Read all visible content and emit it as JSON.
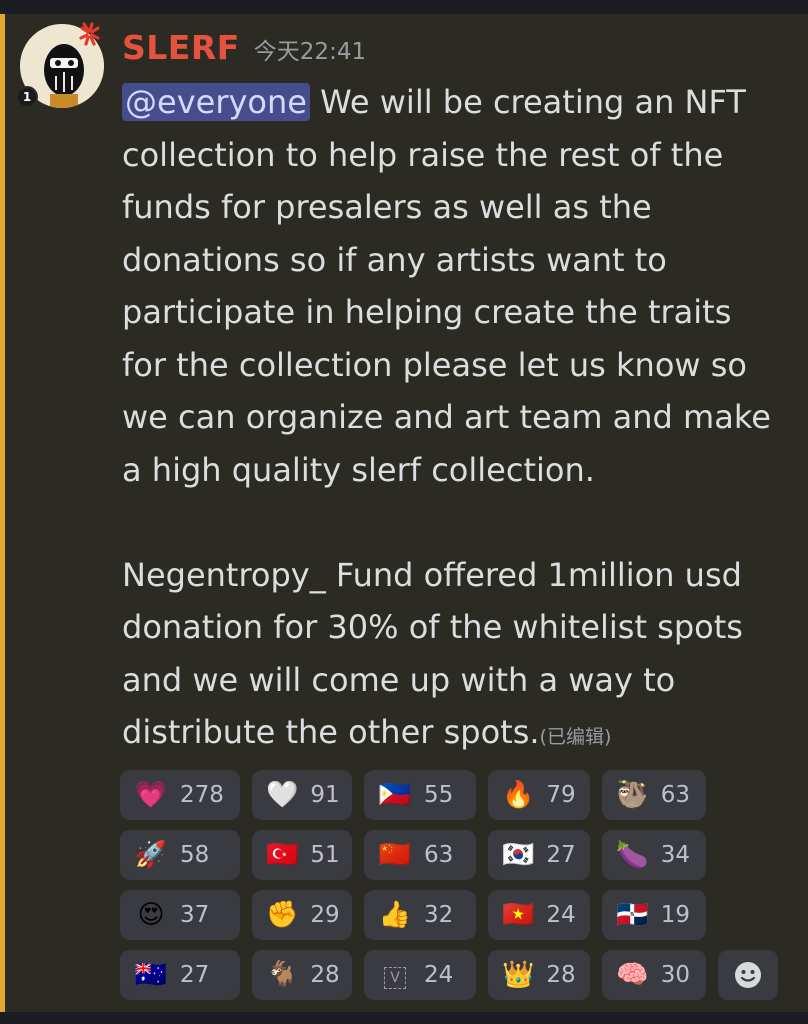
{
  "message": {
    "username": "SLERF",
    "timestamp": "今天22:41",
    "avatar_level": "1",
    "mention": "@everyone",
    "lines_para1": [
      " We will be creating an NFT",
      "collection to help raise the rest of the",
      "funds for presalers as well as the",
      "donations so if any artists want to",
      "participate in helping create the traits",
      "for the collection please let us know so",
      "we can organize and art team and make",
      "a high quality slerf collection."
    ],
    "lines_para2": [
      "Negentropy_ Fund offered 1million usd",
      "donation for 30% of the whitelist spots",
      "and we will come up with a way to",
      "distribute the other spots."
    ],
    "edited_label": "(已编辑)"
  },
  "reactions": [
    [
      {
        "emoji": "💗",
        "icon": "pink-heart-icon",
        "count": "278"
      },
      {
        "emoji": "🤍",
        "icon": "white-heart-icon",
        "count": "91"
      },
      {
        "emoji": "🇵🇭",
        "icon": "philippines-flag-icon",
        "count": "55"
      },
      {
        "emoji": "🔥",
        "icon": "fire-icon",
        "count": "79"
      },
      {
        "emoji": "🦥",
        "icon": "sloth-icon",
        "count": "63"
      }
    ],
    [
      {
        "emoji": "🚀",
        "icon": "rocket-icon",
        "count": "58"
      },
      {
        "emoji": "🇹🇷",
        "icon": "turkey-flag-icon",
        "count": "51"
      },
      {
        "emoji": "🇨🇳",
        "icon": "china-flag-icon",
        "count": "63"
      },
      {
        "emoji": "🇰🇷",
        "icon": "korea-flag-icon",
        "count": "27"
      },
      {
        "emoji": "🍆",
        "icon": "eggplant-icon",
        "count": "34"
      }
    ],
    [
      {
        "emoji": "😍",
        "icon": "heart-eyes-icon",
        "count": "37"
      },
      {
        "emoji": "✊",
        "icon": "raised-fist-icon",
        "count": "29"
      },
      {
        "emoji": "👍",
        "icon": "thumbs-up-icon",
        "count": "32"
      },
      {
        "emoji": "🇻🇳",
        "icon": "vietnam-flag-icon",
        "count": "24"
      },
      {
        "emoji": "🇩🇴",
        "icon": "dominican-flag-icon",
        "count": "19"
      }
    ],
    [
      {
        "emoji": "🇦🇺",
        "icon": "australia-flag-icon",
        "count": "27"
      },
      {
        "emoji": "🐐",
        "icon": "goat-icon",
        "count": "28"
      },
      {
        "emoji": "V",
        "icon": "v-box-icon",
        "count": "24"
      },
      {
        "emoji": "👑",
        "icon": "crown-icon",
        "count": "28"
      },
      {
        "emoji": "🧠",
        "icon": "brain-icon",
        "count": "30"
      }
    ]
  ],
  "colors": {
    "background": "#2b2a23",
    "highlight": "#e4a52c",
    "username": "#e5533f",
    "mention_bg": "#464d8c",
    "reaction_bg": "#3a3b41"
  }
}
